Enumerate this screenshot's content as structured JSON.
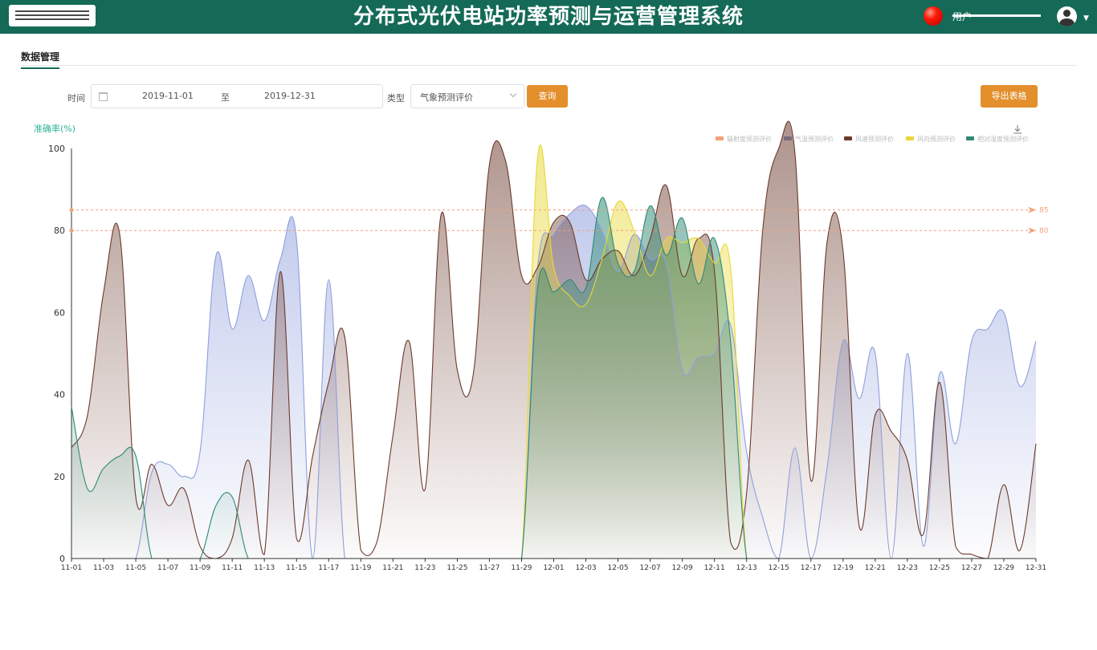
{
  "header": {
    "title": "分布式光伏电站功率预测与运营管理系统",
    "user_name": "用户"
  },
  "tabs": [
    {
      "label": "数据管理"
    }
  ],
  "filters": {
    "time_label": "时间",
    "start_date": "2019-11-01",
    "range_separator": "至",
    "end_date": "2019-12-31",
    "type_label": "类型",
    "type_value": "气象预测评价",
    "query_label": "查询",
    "export_label": "导出表格"
  },
  "colors": {
    "header": "#146a57",
    "accent": "#e38f2c",
    "threshold": "#f4a07a"
  },
  "icons": {
    "download": "download-icon",
    "calendar": "calendar-icon",
    "status": "status-light-icon",
    "user": "user-avatar-icon"
  },
  "chart_data": {
    "type": "area",
    "ylabel": "准确率(%)",
    "ylim": [
      0,
      100
    ],
    "yticks": [
      0,
      20,
      40,
      60,
      80,
      100
    ],
    "x": [
      "11-01",
      "11-02",
      "11-03",
      "11-04",
      "11-05",
      "11-06",
      "11-07",
      "11-08",
      "11-09",
      "11-10",
      "11-11",
      "11-12",
      "11-13",
      "11-14",
      "11-15",
      "11-16",
      "11-17",
      "11-18",
      "11-19",
      "11-20",
      "11-21",
      "11-22",
      "11-23",
      "11-24",
      "11-25",
      "11-26",
      "11-27",
      "11-28",
      "11-29",
      "11-30",
      "12-01",
      "12-02",
      "12-03",
      "12-04",
      "12-05",
      "12-06",
      "12-07",
      "12-08",
      "12-09",
      "12-10",
      "12-11",
      "12-12",
      "12-13",
      "12-14",
      "12-15",
      "12-16",
      "12-17",
      "12-18",
      "12-19",
      "12-20",
      "12-21",
      "12-22",
      "12-23",
      "12-24",
      "12-25",
      "12-26",
      "12-27",
      "12-28",
      "12-29",
      "12-30",
      "12-31"
    ],
    "xticks": [
      "11-01",
      "11-03",
      "11-05",
      "11-07",
      "11-09",
      "11-11",
      "11-13",
      "11-15",
      "11-17",
      "11-19",
      "11-21",
      "11-23",
      "11-25",
      "11-27",
      "11-29",
      "12-01",
      "12-03",
      "12-05",
      "12-07",
      "12-09",
      "12-11",
      "12-13",
      "12-15",
      "12-17",
      "12-19",
      "12-21",
      "12-23",
      "12-25",
      "12-27",
      "12-29",
      "12-31"
    ],
    "thresholds": [
      85,
      80
    ],
    "legend_position": "top-right",
    "series": [
      {
        "name": "辐射度预测评价",
        "color": "#f4a07a",
        "values": [
          0,
          0,
          0,
          0,
          0,
          0,
          0,
          0,
          0,
          0,
          0,
          0,
          0,
          0,
          0,
          0,
          0,
          0,
          0,
          0,
          0,
          0,
          0,
          0,
          0,
          0,
          0,
          0,
          0,
          0,
          0,
          0,
          0,
          0,
          0,
          0,
          0,
          0,
          0,
          0,
          0,
          0,
          0,
          0,
          0,
          0,
          0,
          0,
          0,
          0,
          0,
          0,
          0,
          0,
          0,
          0,
          0,
          0,
          0,
          0,
          0
        ]
      },
      {
        "name": "气温预测评价",
        "color": "#8f9fdc",
        "values": [
          0,
          0,
          0,
          0,
          0,
          21,
          23,
          20,
          26,
          74,
          56,
          69,
          58,
          73,
          78,
          0,
          68,
          0,
          0,
          0,
          0,
          0,
          0,
          0,
          0,
          0,
          0,
          0,
          0,
          71,
          79,
          84,
          86,
          80,
          70,
          79,
          73,
          72,
          46,
          49,
          50,
          57,
          26,
          10,
          0,
          27,
          0,
          22,
          53,
          39,
          50,
          0,
          50,
          3,
          45,
          28,
          53,
          56,
          60,
          42,
          53
        ]
      },
      {
        "name": "风速预测评价",
        "color": "#6b3a2c",
        "values": [
          27,
          35,
          65,
          79,
          15,
          23,
          13,
          17,
          3,
          0,
          5,
          24,
          1,
          70,
          5,
          25,
          43,
          54,
          2,
          4,
          30,
          53,
          17,
          84,
          46,
          45,
          96,
          97,
          69,
          71,
          82,
          82,
          68,
          73,
          75,
          69,
          78,
          91,
          69,
          78,
          70,
          4,
          16,
          80,
          100,
          99,
          19,
          77,
          75,
          8,
          35,
          31,
          24,
          6,
          43,
          3,
          1,
          0,
          18,
          2,
          28
        ]
      },
      {
        "name": "风向预测评价",
        "color": "#e8d835",
        "values": [
          0,
          0,
          0,
          0,
          0,
          0,
          0,
          0,
          0,
          0,
          0,
          0,
          0,
          0,
          0,
          0,
          0,
          0,
          0,
          0,
          0,
          0,
          0,
          0,
          0,
          0,
          0,
          0,
          0,
          98,
          71,
          64,
          62,
          73,
          87,
          80,
          69,
          78,
          77,
          78,
          72,
          71,
          0,
          0,
          0,
          0,
          0,
          0,
          0,
          0,
          0,
          0,
          0,
          0,
          0,
          0,
          0,
          0,
          0,
          0,
          0
        ]
      },
      {
        "name": "相对湿度预测评价",
        "color": "#2e8a74",
        "values": [
          37,
          17,
          22,
          25,
          25,
          0,
          0,
          0,
          0,
          13,
          15,
          0,
          0,
          0,
          0,
          0,
          0,
          0,
          0,
          0,
          0,
          0,
          0,
          0,
          0,
          0,
          0,
          0,
          0,
          66,
          65,
          68,
          66,
          88,
          72,
          70,
          86,
          74,
          83,
          67,
          78,
          53,
          0,
          0,
          0,
          0,
          0,
          0,
          0,
          0,
          0,
          0,
          0,
          0,
          0,
          0,
          0,
          0,
          0,
          0,
          0
        ]
      }
    ]
  }
}
